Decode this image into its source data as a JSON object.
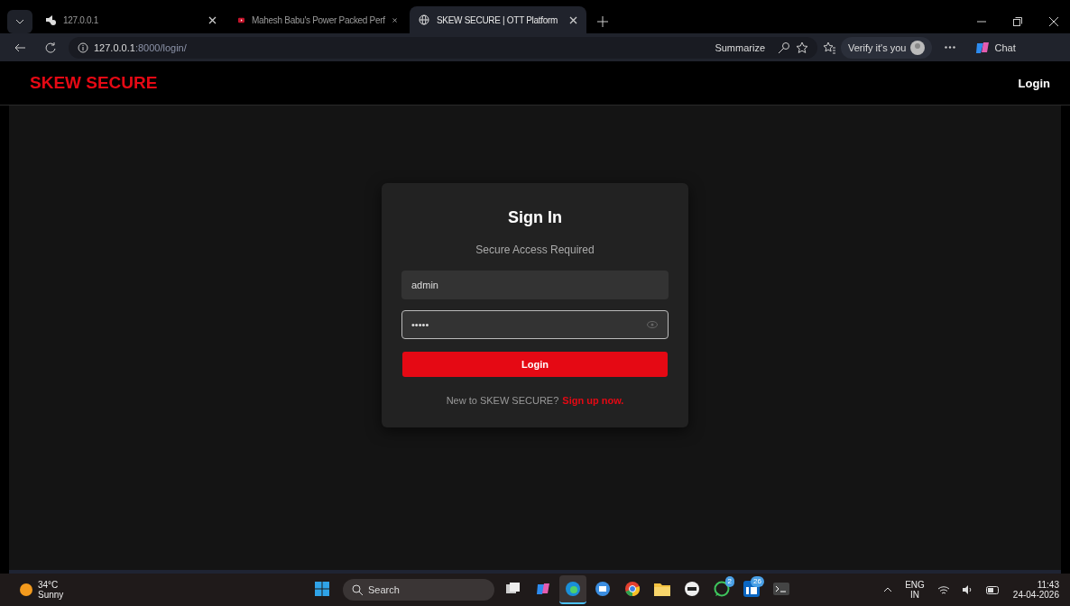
{
  "browser": {
    "tabs": [
      {
        "title": "127.0.0.1",
        "kind": "muted",
        "selected": false
      },
      {
        "title": "Mahesh Babu's Power Packed Perf",
        "kind": "video",
        "selected": false
      },
      {
        "title": "SKEW SECURE | OTT Platform",
        "kind": "globe",
        "selected": true
      }
    ],
    "address": {
      "host": "127.0.0.1",
      "path": ":8000/login/"
    },
    "toolbar": {
      "summarize": "Summarize",
      "verify": "Verify it's you",
      "chat": "Chat"
    }
  },
  "site": {
    "brand": "SKEW SECURE",
    "nav_login": "Login"
  },
  "signin": {
    "title": "Sign In",
    "subtitle": "Secure Access Required",
    "username": {
      "value": "admin",
      "focused": false
    },
    "password": {
      "value": "•••••",
      "focused": true
    },
    "button": "Login",
    "prompt": "New to SKEW SECURE?",
    "signup_link": "Sign up now."
  },
  "taskbar": {
    "weather": {
      "temp": "34°C",
      "condition": "Sunny"
    },
    "search": "Search",
    "apps": [
      {
        "kind": "taskview",
        "selected": false
      },
      {
        "kind": "copilot",
        "selected": false
      },
      {
        "kind": "edge",
        "selected": true
      },
      {
        "kind": "mail",
        "selected": false
      },
      {
        "kind": "chrome",
        "selected": false
      },
      {
        "kind": "folder",
        "selected": false
      },
      {
        "kind": "news",
        "selected": false
      },
      {
        "kind": "whatsapp",
        "badge": "2",
        "selected": false
      },
      {
        "kind": "linkedin",
        "badge": "26",
        "selected": false
      },
      {
        "kind": "terminal",
        "selected": false
      }
    ],
    "language": "ENG",
    "region": "IN",
    "time": "11:43",
    "date": "24-04-2026"
  }
}
